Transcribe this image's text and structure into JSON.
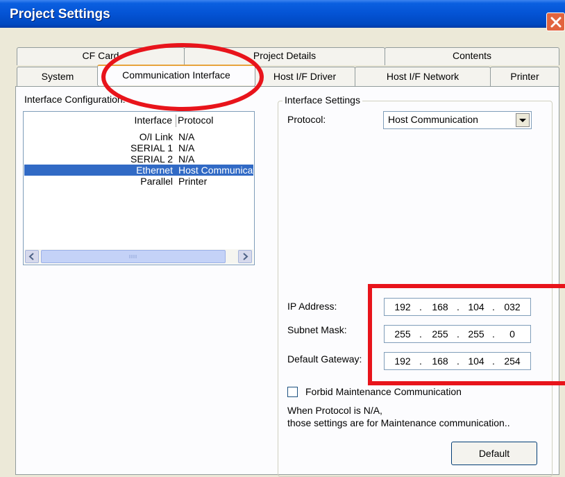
{
  "window": {
    "title": "Project Settings"
  },
  "tabs_row1": [
    {
      "label": "CF Card"
    },
    {
      "label": "Project Details"
    },
    {
      "label": "Contents"
    }
  ],
  "tabs_row2": [
    {
      "label": "System"
    },
    {
      "label": "Communication Interface"
    },
    {
      "label": "Host I/F Driver"
    },
    {
      "label": "Host I/F Network"
    },
    {
      "label": "Printer"
    }
  ],
  "interface_config": {
    "label": "Interface Configuration:",
    "columns": [
      "Interface",
      "Protocol"
    ],
    "rows": [
      {
        "interface": "O/I Link",
        "protocol": "N/A"
      },
      {
        "interface": "SERIAL 1",
        "protocol": "N/A"
      },
      {
        "interface": "SERIAL 2",
        "protocol": "N/A"
      },
      {
        "interface": "Ethernet",
        "protocol": "Host Communication"
      },
      {
        "interface": "Parallel",
        "protocol": "Printer"
      }
    ],
    "selected_row": 3
  },
  "settings": {
    "group_label": "Interface Settings",
    "protocol_label": "Protocol:",
    "protocol_value": "Host Communication",
    "ip_label": "IP Address:",
    "ip": [
      "192",
      "168",
      "104",
      "032"
    ],
    "subnet_label": "Subnet Mask:",
    "subnet": [
      "255",
      "255",
      "255",
      "0"
    ],
    "gateway_label": "Default Gateway:",
    "gateway": [
      "192",
      "168",
      "104",
      "254"
    ],
    "forbid_label": "Forbid Maintenance Communication",
    "forbid_checked": false,
    "note_line1": "When Protocol is N/A,",
    "note_line2": "those settings are for Maintenance communication..",
    "default_button": "Default"
  },
  "colors": {
    "selection": "#316ac5",
    "annotation": "#e8141b",
    "titlebar": "#0453d4"
  }
}
